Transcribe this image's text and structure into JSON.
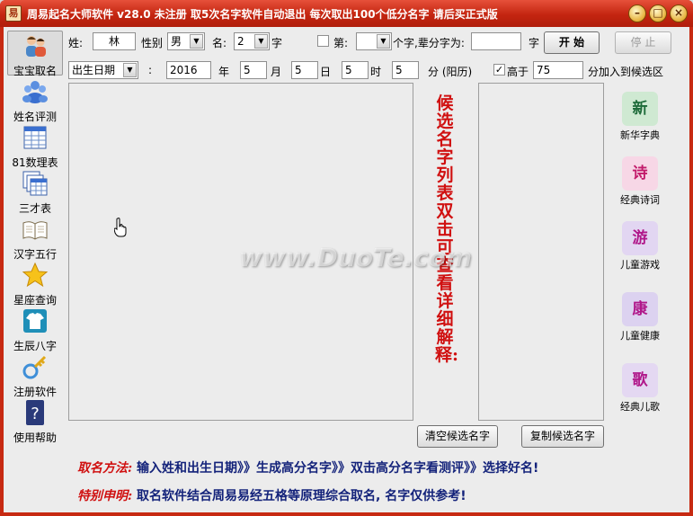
{
  "window": {
    "app_icon": "易",
    "title": "周易起名大师软件 v28.0   未注册   取5次名字软件自动退出 每次取出100个低分名字 请后买正式版",
    "buttons": {
      "minimize": "–",
      "maximize": "□",
      "close": "×"
    }
  },
  "sidebar": {
    "items": [
      {
        "label": "宝宝取名",
        "icon": "baby-icon",
        "active": true
      },
      {
        "label": "姓名评测",
        "icon": "people-icon"
      },
      {
        "label": "81数理表",
        "icon": "table-icon"
      },
      {
        "label": "三才表",
        "icon": "table-stack-icon"
      },
      {
        "label": "汉字五行",
        "icon": "book-icon"
      },
      {
        "label": "星座查询",
        "icon": "star-icon"
      },
      {
        "label": "生辰八字",
        "icon": "shirt-icon"
      },
      {
        "label": "注册软件",
        "icon": "key-icon"
      },
      {
        "label": "使用帮助",
        "icon": "help-icon"
      }
    ]
  },
  "form": {
    "surname_label": "姓:",
    "surname_value": "林",
    "gender_label": "性别",
    "gender_value": "男",
    "name_label": "名:",
    "name_count_value": "2",
    "name_count_suffix": "字",
    "fixed_char_checked": false,
    "fixed_char_label": "第:",
    "fixed_char_position_value": "",
    "fixed_char_suffix": "个字,辈分字为:",
    "generation_char_value": "",
    "generation_char_suffix": "字",
    "start_button": "开 始",
    "stop_button": "停 止",
    "date_type_value": "出生日期",
    "colon": ":",
    "year_value": "2016",
    "year_label": "年",
    "month_value": "5",
    "month_label": "月",
    "day_value": "5",
    "day_label": "日",
    "hour_value": "5",
    "hour_label": "时",
    "minute_value": "5",
    "minute_label": "分 (阳历)",
    "score_checked": true,
    "score_above_label": "高于",
    "score_value": "75",
    "score_suffix": "分加入到候选区"
  },
  "candidate_hint": "候选名字列表双击可查看详细解释:",
  "buttons": {
    "clear_candidates": "清空候选名字",
    "copy_candidates": "复制候选名字"
  },
  "right_panel": {
    "items": [
      {
        "glyph": "新",
        "label": "新华字典",
        "icon": "dictionary-icon",
        "color": "#1e6b3a",
        "bg": "#cfe9d2"
      },
      {
        "glyph": "诗",
        "label": "经典诗词",
        "icon": "poem-icon",
        "color": "#c21b6b",
        "bg": "#f7d7e6"
      },
      {
        "glyph": "游",
        "label": "儿童游戏",
        "icon": "game-icon",
        "color": "#b0178a",
        "bg": "#e2d6f2"
      },
      {
        "glyph": "康",
        "label": "儿童健康",
        "icon": "health-icon",
        "color": "#b0178a",
        "bg": "#dcd2f0"
      },
      {
        "glyph": "歌",
        "label": "经典儿歌",
        "icon": "song-icon",
        "color": "#b0178a",
        "bg": "#e4d8f2"
      }
    ]
  },
  "footer": {
    "method_heading": "取名方法:",
    "method_text": "输入姓和出生日期》》生成高分名字》》双击高分名字看测评》》选择好名!",
    "notice_heading": "特别申明:",
    "notice_text": "取名软件结合周易易经五格等原理综合取名, 名字仅供参考!"
  },
  "watermark": "www.DuoTe.com"
}
